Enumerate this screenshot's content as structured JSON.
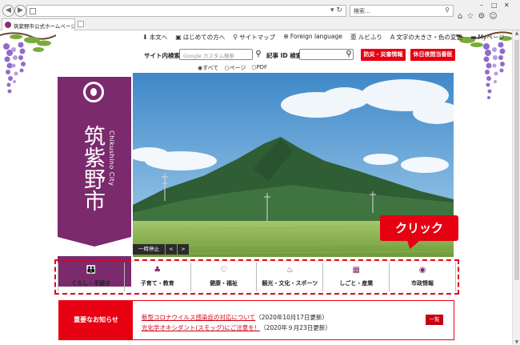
{
  "browser": {
    "search_placeholder": "検索...",
    "tab_title": "筑紫野市公式ホームページ",
    "search_icon": "magnifier-icon"
  },
  "utility_links": [
    {
      "icon": "⬇",
      "label": "本文へ"
    },
    {
      "icon": "▣",
      "label": "はじめての方へ"
    },
    {
      "icon": "⚲",
      "label": "サイトマップ"
    },
    {
      "icon": "⊕",
      "label": "Foreign language"
    },
    {
      "icon": "亜",
      "label": "ルビふり"
    },
    {
      "icon": "A",
      "label": "文字の大きさ・色の変更"
    },
    {
      "icon": "▬",
      "label": "Myページ"
    }
  ],
  "site_search": {
    "label": "サイト内検索",
    "placeholder": "Google カスタム検索",
    "options": [
      "すべて",
      "ページ",
      "PDF"
    ],
    "selected": "すべて"
  },
  "article_search": {
    "label": "記事 ID 検索",
    "value": ""
  },
  "emergency_buttons": [
    "防災・災害情報",
    "休日夜間当番医"
  ],
  "city": {
    "name_kanji": "筑紫野市",
    "name_roman": "Chikushino City"
  },
  "slideshow": {
    "pause_label": "一時停止",
    "prev_label": "<",
    "next_label": ">"
  },
  "callout": "クリック",
  "categories": [
    {
      "icon": "people-icon",
      "glyph": "👪",
      "label": "くらし・手続き"
    },
    {
      "icon": "stroller-icon",
      "glyph": "♣",
      "label": "子育て・教育"
    },
    {
      "icon": "stethoscope-icon",
      "glyph": "♡",
      "label": "健康・福祉"
    },
    {
      "icon": "hot-spring-icon",
      "glyph": "♨",
      "label": "観光・文化・スポーツ"
    },
    {
      "icon": "building-icon",
      "glyph": "▦",
      "label": "しごと・産業"
    },
    {
      "icon": "city-emblem-icon",
      "glyph": "◉",
      "label": "市政情報"
    }
  ],
  "notice": {
    "heading": "重要なお知らせ",
    "items": [
      {
        "text": "新型コロナウイルス感染症の対応について",
        "date": "（2020年10月17日更新）"
      },
      {
        "text": "光化学オキシダント(スモッグ)にご注意を！",
        "date": "（2020年９月23日更新）"
      }
    ],
    "more_label": "一覧"
  },
  "colors": {
    "brand_purple": "#7b2a6d",
    "accent_red": "#e60012"
  }
}
